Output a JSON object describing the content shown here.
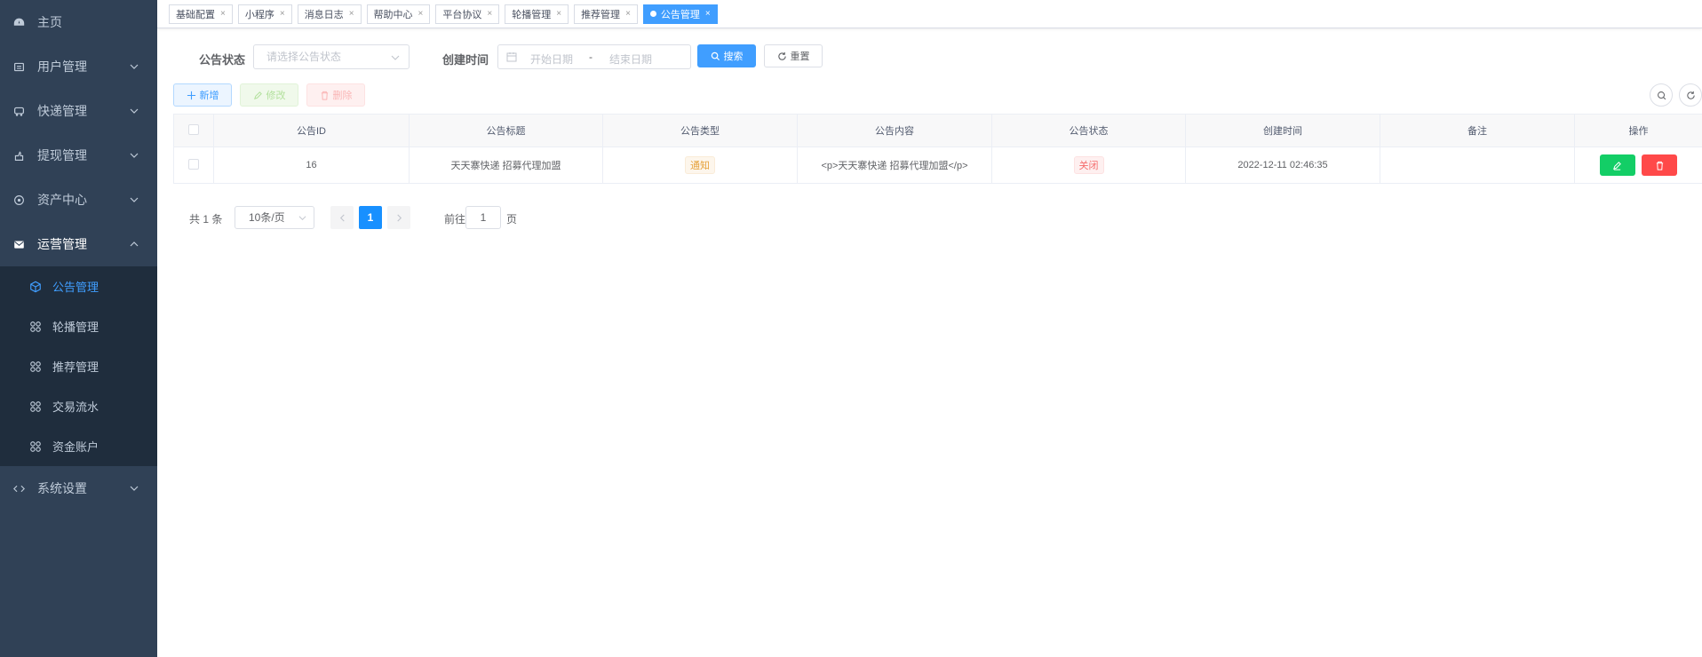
{
  "sidebar": {
    "items": [
      {
        "label": "主页",
        "icon": "dashboard-icon"
      },
      {
        "label": "用户管理",
        "icon": "user-icon"
      },
      {
        "label": "快递管理",
        "icon": "car-icon"
      },
      {
        "label": "提现管理",
        "icon": "withdraw-icon"
      },
      {
        "label": "资产中心",
        "icon": "asset-icon"
      },
      {
        "label": "运营管理",
        "icon": "mail-icon"
      },
      {
        "label": "系统设置",
        "icon": "code-icon"
      }
    ],
    "sub_items": [
      {
        "label": "公告管理"
      },
      {
        "label": "轮播管理"
      },
      {
        "label": "推荐管理"
      },
      {
        "label": "交易流水"
      },
      {
        "label": "资金账户"
      }
    ]
  },
  "tags": [
    {
      "label": "基础配置"
    },
    {
      "label": "小程序"
    },
    {
      "label": "消息日志"
    },
    {
      "label": "帮助中心"
    },
    {
      "label": "平台协议"
    },
    {
      "label": "轮播管理"
    },
    {
      "label": "推荐管理"
    },
    {
      "label": "公告管理"
    }
  ],
  "tag_close": "×",
  "search": {
    "status_label": "公告状态",
    "status_placeholder": "请选择公告状态",
    "created_label": "创建时间",
    "start_placeholder": "开始日期",
    "range_sep": "-",
    "end_placeholder": "结束日期",
    "search_btn": "搜索",
    "reset_btn": "重置"
  },
  "toolbar": {
    "add": "新增",
    "edit": "修改",
    "delete": "删除"
  },
  "table": {
    "headers": [
      "公告ID",
      "公告标题",
      "公告类型",
      "公告内容",
      "公告状态",
      "创建时间",
      "备注",
      "操作"
    ],
    "rows": [
      {
        "id": "16",
        "title": "天天寨快递 招募代理加盟",
        "type": "通知",
        "content": "<p>天天寨快递 招募代理加盟</p>",
        "status": "关闭",
        "created": "2022-12-11 02:46:35",
        "remark": ""
      }
    ]
  },
  "pagination": {
    "total": "共 1 条",
    "page_size": "10条/页",
    "current": "1",
    "goto_label": "前往",
    "goto_value": "1",
    "page_word": "页"
  },
  "colors": {
    "primary": "#409eff",
    "sidebar_bg": "#304156",
    "submenu_bg": "#1f2d3d",
    "success": "#13ce66",
    "danger": "#ff4949"
  }
}
